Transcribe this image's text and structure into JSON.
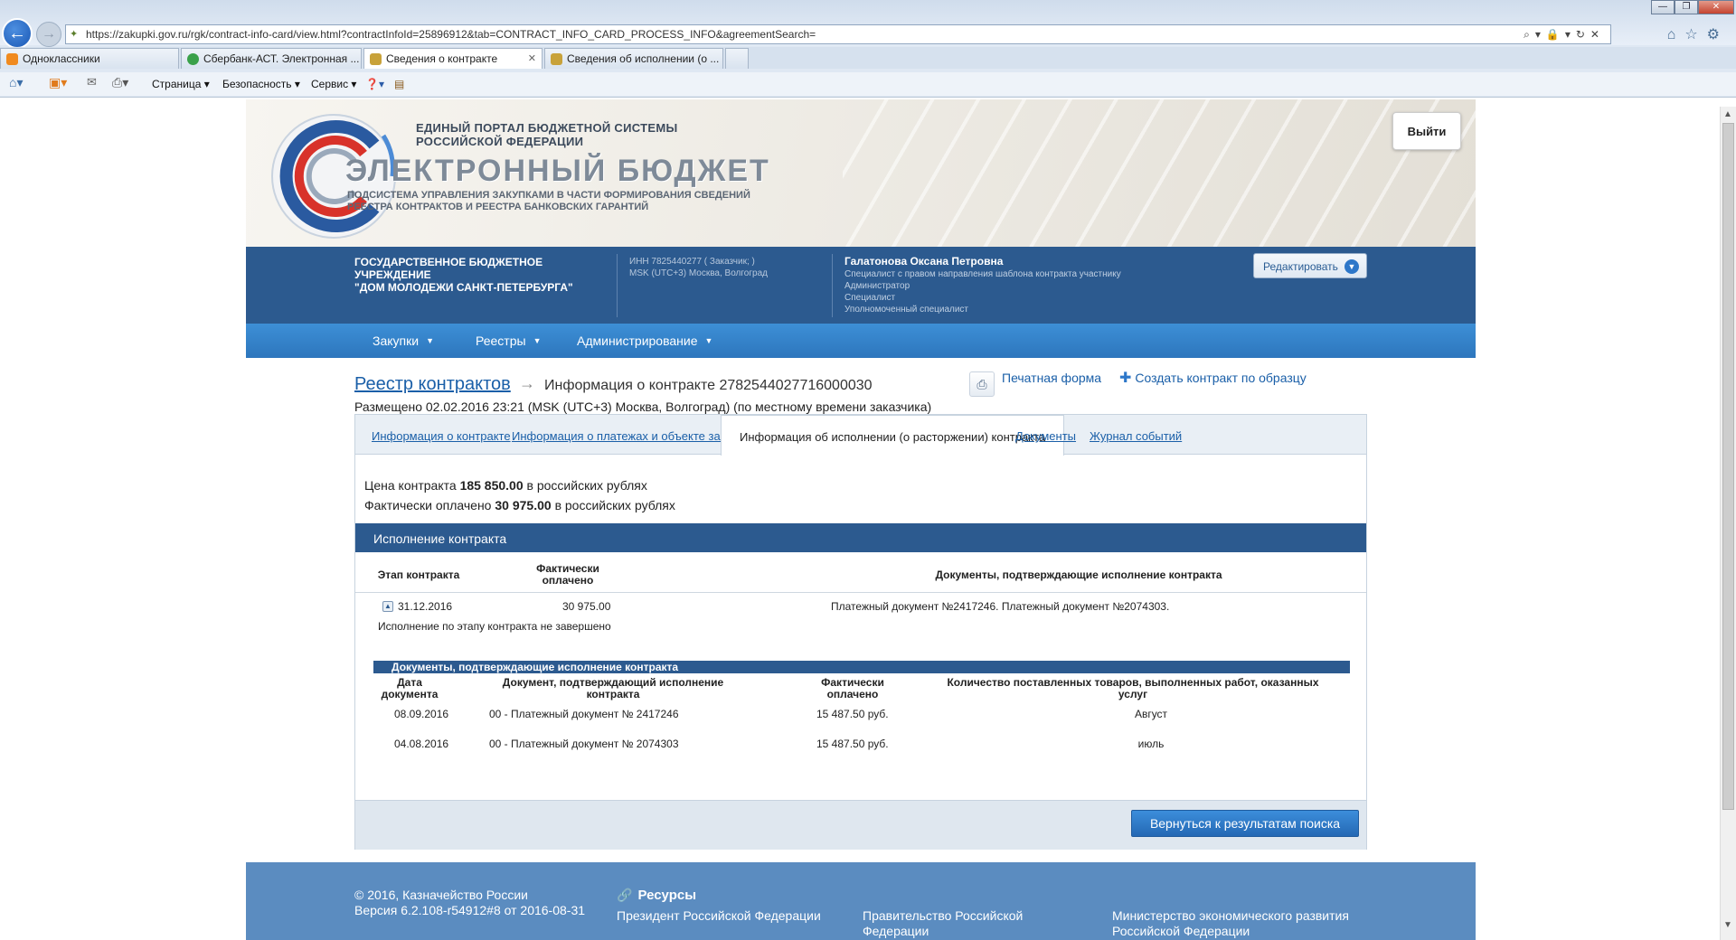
{
  "browser": {
    "url": "https://zakupki.gov.ru/rgk/contract-info-card/view.html?contractInfoId=25896912&tab=CONTRACT_INFO_CARD_PROCESS_INFO&agreementSearch=",
    "tabs": [
      {
        "label": "Одноклассники",
        "color": "#f08a1f"
      },
      {
        "label": "Сбербанк-АСТ. Электронная ...",
        "color": "#3aa14a"
      },
      {
        "label": "Сведения о контракте",
        "color": "#c8a23a"
      },
      {
        "label": "Сведения об исполнении (о ...",
        "color": "#c8a23a"
      }
    ],
    "commands": {
      "page": "Страница",
      "security": "Безопасность",
      "service": "Сервис"
    }
  },
  "header": {
    "portal_title_1": "ЕДИНЫЙ ПОРТАЛ БЮДЖЕТНОЙ СИСТЕМЫ",
    "portal_title_2": "РОССИЙСКОЙ ФЕДЕРАЦИИ",
    "brand": "ЭЛЕКТРОННЫЙ БЮДЖЕТ",
    "subtitle_1": "ПОДСИСТЕМА УПРАВЛЕНИЯ ЗАКУПКАМИ В ЧАСТИ ФОРМИРОВАНИЯ СВЕДЕНИЙ",
    "subtitle_2": "РЕЕСТРА КОНТРАКТОВ И РЕЕСТРА БАНКОВСКИХ ГАРАНТИЙ",
    "logout": "Выйти"
  },
  "org": {
    "name_1": "ГОСУДАРСТВЕННОЕ БЮДЖЕТНОЕ УЧРЕЖДЕНИЕ",
    "name_2": "\"ДОМ МОЛОДЕЖИ САНКТ-ПЕТЕРБУРГА\"",
    "inn": "ИНН 7825440277 ( Заказчик; )",
    "tz": "MSK (UTC+3) Москва, Волгоград",
    "user": "Галатонова Оксана Петровна",
    "roles": [
      "Специалист с правом направления шаблона контракта участнику",
      "Администратор",
      "Специалист",
      "Уполномоченный специалист"
    ],
    "edit": "Редактировать"
  },
  "menu": [
    "Закупки",
    "Реестры",
    "Администрирование"
  ],
  "breadcrumb": {
    "registry": "Реестр контрактов",
    "current": "Информация о контракте 2782544027716000030",
    "print": "Печатная форма",
    "create": "Создать контракт по образцу",
    "posted": "Размещено 02.02.2016 23:21 (MSK (UTC+3) Москва, Волгоград) (по местному времени заказчика)"
  },
  "card_tabs": [
    "Информация о контракте",
    "Информация о платежах и объекте закупки",
    "Информация об исполнении (о расторжении) контракта",
    "Документы",
    "Журнал событий"
  ],
  "prices": {
    "contract_label": "Цена контракта",
    "contract_value": "185 850.00",
    "contract_unit": "в российских рублях",
    "paid_label": "Фактически оплачено",
    "paid_value": "30 975.00",
    "paid_unit": "в российских рублях"
  },
  "execution": {
    "title": "Исполнение контракта",
    "col_stage": "Этап контракта",
    "col_paid_1": "Фактически",
    "col_paid_2": "оплачено",
    "col_docs": "Документы, подтверждающие исполнение контракта",
    "stage_date": "31.12.2016",
    "stage_paid": "30 975.00",
    "stage_docs": "Платежный документ №2417246. Платежный документ №2074303.",
    "stage_status": "Исполнение по этапу контракта не завершено"
  },
  "docs": {
    "title": "Документы, подтверждающие исполнение контракта",
    "col_date_1": "Дата",
    "col_date_2": "документа",
    "col_doc_1": "Документ, подтверждающий исполнение",
    "col_doc_2": "контракта",
    "col_paid_1": "Фактически",
    "col_paid_2": "оплачено",
    "col_qty_1": "Количество поставленных товаров, выполненных работ, оказанных",
    "col_qty_2": "услуг",
    "rows": [
      {
        "date": "08.09.2016",
        "doc": "00 - Платежный документ № 2417246",
        "paid": "15 487.50 руб.",
        "qty": "Август"
      },
      {
        "date": "04.08.2016",
        "doc": "00 - Платежный документ № 2074303",
        "paid": "15 487.50 руб.",
        "qty": "июль"
      }
    ]
  },
  "back_button": "Вернуться к результатам поиска",
  "footer": {
    "copy": "© 2016, Казначейство России",
    "version": "Версия 6.2.108-r54912#8 от 2016-08-31",
    "resources": "Ресурсы",
    "link1_1": "Президент Российской Федерации",
    "link2_1": "Правительство Российской",
    "link2_2": "Федерации",
    "link3_1": "Министерство экономического развития",
    "link3_2": "Российской Федерации"
  },
  "colors": {
    "accent": "#2c5a8f",
    "menu": "#3d8fd6",
    "link": "#1a5fa8"
  }
}
